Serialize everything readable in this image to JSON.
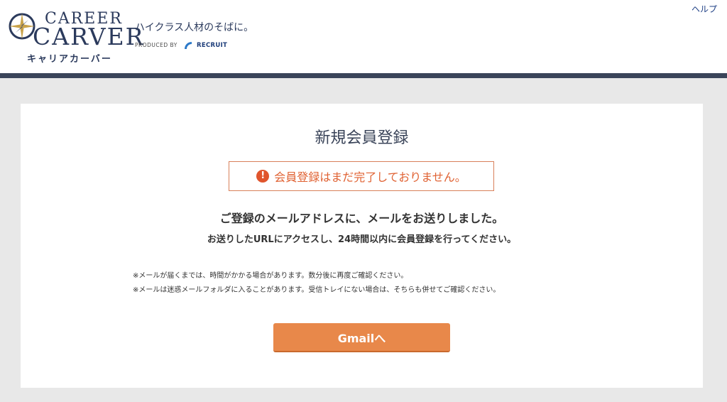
{
  "header": {
    "logo": {
      "line1": "CAREER",
      "line2": "CARVER",
      "kana": "キャリアカーバー"
    },
    "tagline": "ハイクラス人材のそばに。",
    "produced_by": "PRODUCED BY",
    "partner": "RECRUIT",
    "help_label": "ヘルプ"
  },
  "main": {
    "title": "新規会員登録",
    "alert": {
      "icon": "exclamation-icon",
      "text": "会員登録はまだ完了しておりません。"
    },
    "message": "ご登録のメールアドレスに、メールをお送りしました。",
    "sub_message": "お送りしたURLにアクセスし、24時間以内に会員登録を行ってください。",
    "notes": [
      "※メールが届くまでは、時間がかかる場合があります。数分後に再度ご確認ください。",
      "※メールは迷惑メールフォルダに入ることがあります。受信トレイにない場合は、そちらも併せてご確認ください。"
    ],
    "button_label": "Gmailへ"
  },
  "colors": {
    "brand_navy": "#2b3a5c",
    "header_rule": "#3a4459",
    "alert_orange": "#e06233",
    "button_orange": "#e8884a",
    "page_background": "#e8e8e8"
  }
}
